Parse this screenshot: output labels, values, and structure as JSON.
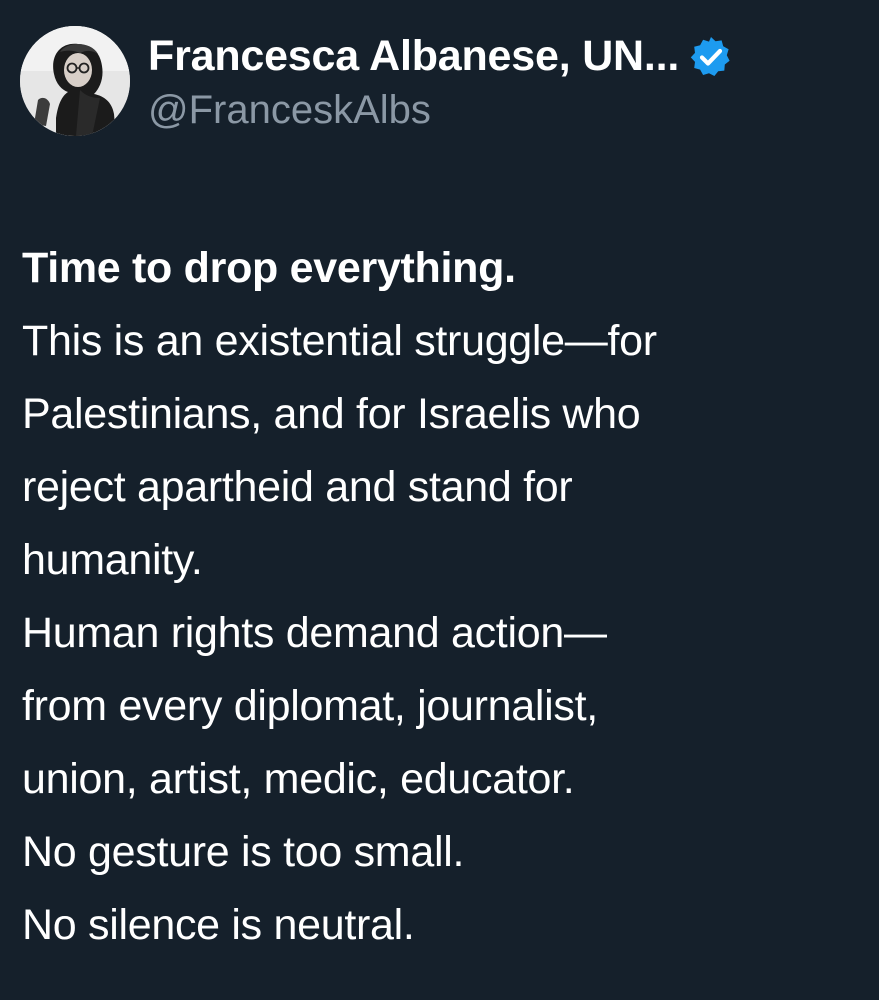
{
  "author": {
    "display_name": "Francesca Albanese, UN...",
    "handle": "@FranceskAlbs",
    "verified": true,
    "verified_icon": "verified-badge-icon",
    "avatar_icon": "avatar-photo"
  },
  "colors": {
    "background": "#15202b",
    "text": "#ffffff",
    "handle": "#8b98a5",
    "verified": "#1d9bf0"
  },
  "tweet": {
    "lines": [
      "Time to drop everything.",
      "This is an existential struggle—for",
      "Palestinians, and for Israelis who",
      "reject apartheid and stand for",
      "humanity.",
      "Human rights demand action—",
      "from every diplomat, journalist,",
      "union, artist, medic, educator.",
      "No gesture is too small.",
      "No silence is neutral."
    ]
  }
}
